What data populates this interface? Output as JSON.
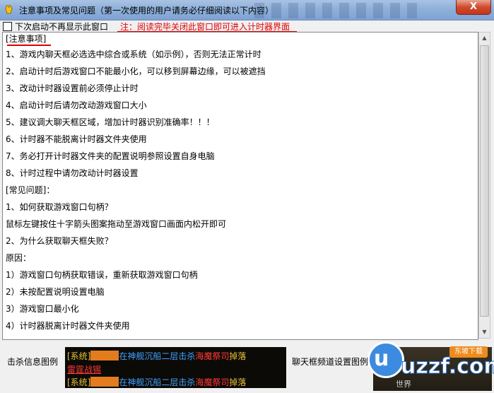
{
  "window": {
    "title": "注意事项及常见问题（第一次使用的用户请务必仔细阅读以下内容）",
    "close_label": "X"
  },
  "options": {
    "dont_show_label": "下次启动不再显示此窗口",
    "dont_show_checked": false,
    "notice": "注：阅读完毕关闭此窗口即可进入计时器界面"
  },
  "content": {
    "lines": [
      "[注意事项]",
      "1、游戏内聊天框必选选中综合或系统（如示例），否则无法正常计时",
      "2、启动计时后游戏窗口不能最小化，可以移到屏幕边缘，可以被遮挡",
      "3、改动计时器设置前必须停止计时",
      "4、启动计时后请勿改动游戏窗口大小",
      "5、建议调大聊天框区域，增加计时器识别准确率！！！",
      "6、计时器不能脱离计时器文件夹使用",
      "7、务必打开计时器文件夹的配置说明参照设置自身电脑",
      "8、计时过程中请勿改动计时器设置",
      "[常见问题]：",
      "1、如何获取游戏窗口句柄？",
      "鼠标左键按住十字箭头图案拖动至游戏窗口画面内松开即可",
      "2、为什么获取聊天框失败？",
      "原因：",
      "1）游戏窗口句柄获取错误，重新获取游戏窗口句柄",
      "2）未按配置说明设置电脑",
      "3）游戏窗口最小化",
      "4）计时器脱离计时器文件夹使用"
    ]
  },
  "bottom": {
    "kill_label": "击杀信息图例",
    "chat_label": "聊天框频道设置图例",
    "game_line1": {
      "prefix": "[系统]",
      "mid": "在神舰沉船二层击杀",
      "boss": "海魔祭司",
      "suffix": "掉落"
    },
    "game_line2_link": "雷霆战锡",
    "game_line3": {
      "prefix": "[系统]",
      "mid": "在神舰沉船二层击杀",
      "boss": "海魔祭司",
      "suffix": "掉落"
    },
    "chat_world_tab": "世界"
  },
  "watermark": {
    "brand": "uzzf.com",
    "badge": "东坡下载",
    "com": ".com"
  },
  "colors": {
    "notice_red": "#e00000",
    "game_gold": "#e8c23a",
    "game_blue": "#41a0ff",
    "game_red": "#ff3a3a"
  }
}
